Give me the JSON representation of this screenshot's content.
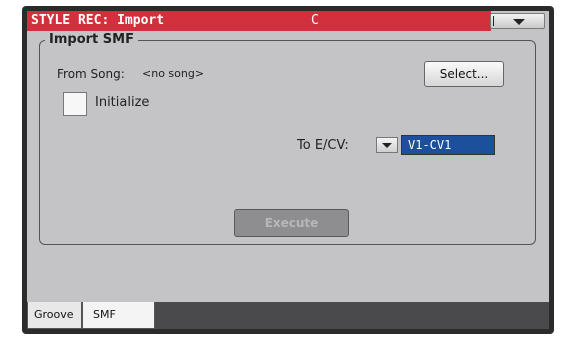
{
  "title": {
    "main": "STYLE REC: Import",
    "status": "C"
  },
  "group": {
    "title": "Import SMF"
  },
  "from_song": {
    "label": "From Song:",
    "value": "<no song>"
  },
  "select_button": {
    "label": "Select..."
  },
  "initialize": {
    "label": "Initialize",
    "checked": false
  },
  "to_ecv": {
    "label": "To E/CV:",
    "value": "V1-CV1"
  },
  "execute_button": {
    "label": "Execute",
    "enabled": false
  },
  "tabs": [
    {
      "label": "Groove"
    },
    {
      "label": "SMF",
      "active": true
    }
  ],
  "colors": {
    "title_bar": "#d42f3c",
    "screen_bg": "#c4c4c6",
    "selection": "#1c4f9c"
  }
}
